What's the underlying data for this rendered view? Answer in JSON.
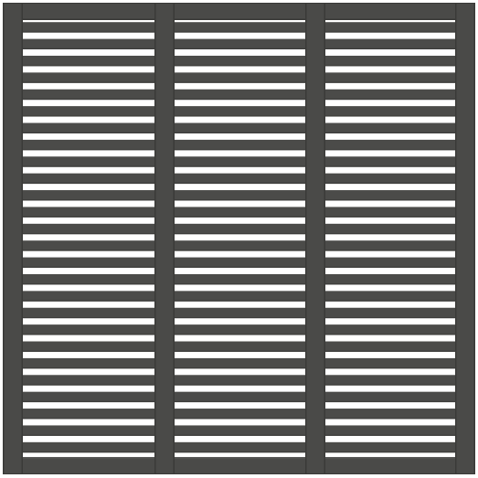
{
  "image": {
    "subject": "fence-panel",
    "colors": {
      "frame": "#4a4a48",
      "frame_edge": "#3a3a38",
      "frame_highlight": "#5a5a58",
      "slat": "#4b4b49",
      "slat_shadow": "#3d3d3b",
      "background": "#ffffff"
    },
    "section_count": 3,
    "slats_per_section": 26
  }
}
